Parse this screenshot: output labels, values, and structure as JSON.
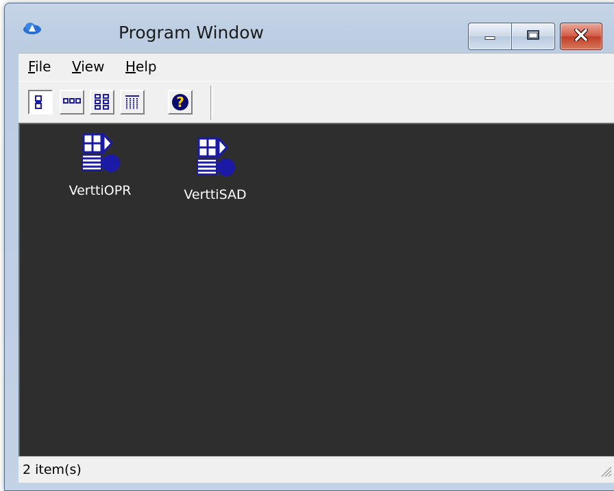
{
  "window": {
    "title": "Program Window"
  },
  "menu": {
    "items": [
      {
        "label": "File",
        "accel": "F",
        "rest": "ile"
      },
      {
        "label": "View",
        "accel": "V",
        "rest": "iew"
      },
      {
        "label": "Help",
        "accel": "H",
        "rest": "elp"
      }
    ]
  },
  "toolbar": {
    "buttons": [
      {
        "name": "large-icons",
        "icon": "large-icons-view-icon",
        "pressed": true
      },
      {
        "name": "small-icons",
        "icon": "small-icons-view-icon",
        "pressed": false
      },
      {
        "name": "list",
        "icon": "list-view-icon",
        "pressed": false
      },
      {
        "name": "details",
        "icon": "details-view-icon",
        "pressed": false
      },
      {
        "name": "help",
        "icon": "help-icon",
        "pressed": false
      }
    ]
  },
  "items": [
    {
      "label": "VerttiOPR",
      "icon": "application-icon"
    },
    {
      "label": "VerttiSAD",
      "icon": "application-icon"
    }
  ],
  "status": {
    "text": "2 item(s)"
  },
  "colors": {
    "content_bg": "#2e2e2e",
    "icon_blue": "#1a1aa6",
    "close_red": "#c03c26"
  }
}
